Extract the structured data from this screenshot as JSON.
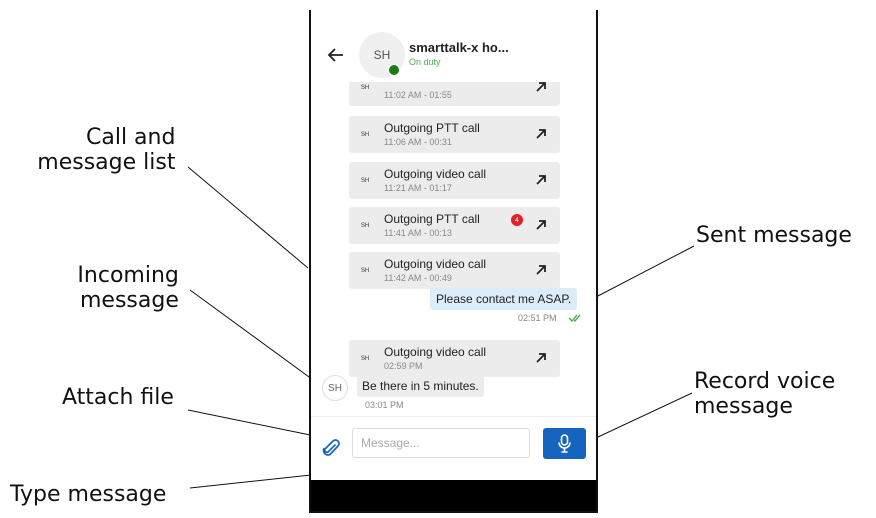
{
  "callouts": {
    "call_list": [
      "Call and",
      "message list"
    ],
    "incoming": [
      "Incoming",
      "message"
    ],
    "attach": "Attach file",
    "type_message": "Type message",
    "sent": "Sent message",
    "record_voice": [
      "Record voice",
      "message"
    ]
  },
  "header": {
    "avatar_initials": "SH",
    "contact_name": "smarttalk-x ho...",
    "status": "On duty",
    "status_color": "#4caf50",
    "presence_color": "#1a7a1a"
  },
  "calls": [
    {
      "avatar": "SH",
      "title": "",
      "time": "11:02 AM - 01:55"
    },
    {
      "avatar": "SH",
      "title": "Outgoing PTT call",
      "time": "11:06 AM - 00:31"
    },
    {
      "avatar": "SH",
      "title": "Outgoing video call",
      "time": "11:21 AM - 01:17"
    },
    {
      "avatar": "SH",
      "title": "Outgoing PTT call",
      "time": "11:41 AM - 00:13",
      "badge": "4"
    },
    {
      "avatar": "SH",
      "title": "Outgoing video call",
      "time": "11:42 AM - 00:49"
    },
    {
      "avatar": "SH",
      "title": "Outgoing video call",
      "time": "02:59 PM"
    }
  ],
  "sent_message": {
    "text": "Please contact me ASAP.",
    "time": "02:51 PM"
  },
  "incoming_message": {
    "avatar": "SH",
    "text": "Be there in 5 minutes.",
    "time": "03:01 PM"
  },
  "composer": {
    "placeholder": "Message...",
    "value": ""
  },
  "colors": {
    "accent": "#1565c0",
    "sent_bubble": "#dcecfa",
    "card": "#ececec",
    "badge": "#e0202a",
    "read_check": "#4caf50"
  }
}
